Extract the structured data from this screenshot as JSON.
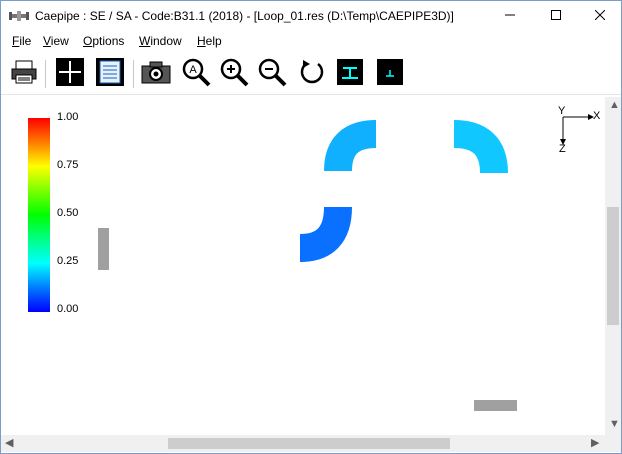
{
  "window": {
    "title": "Caepipe : SE / SA - Code:B31.1 (2018) -  [Loop_01.res (D:\\Temp\\CAEPIPE3D)]",
    "minimize_icon": "minimize-icon",
    "maximize_icon": "maximize-icon",
    "close_icon": "close-icon"
  },
  "menu": {
    "items": [
      {
        "accel": "F",
        "rest": "ile"
      },
      {
        "accel": "V",
        "rest": "iew"
      },
      {
        "accel": "O",
        "rest": "ptions"
      },
      {
        "accel": "W",
        "rest": "indow"
      },
      {
        "accel": "H",
        "rest": "elp"
      }
    ]
  },
  "toolbar": {
    "buttons": [
      "print-icon",
      "node-cross-icon",
      "text-list-icon",
      "camera-icon",
      "zoom-all-icon",
      "zoom-in-icon",
      "zoom-out-icon",
      "rotate-icon",
      "support-t-icon",
      "support-small-icon"
    ]
  },
  "legend": {
    "labels": [
      "1.00",
      "0.75",
      "0.50",
      "0.25",
      "0.00"
    ]
  },
  "axes": {
    "x": "X",
    "y": "Y",
    "z": "Z"
  },
  "colors": {
    "title_bar": "#ffffff",
    "support": "#a0a0a0",
    "scrollbar_track": "#f0f0f0",
    "scrollbar_thumb": "#cdcdcd"
  }
}
